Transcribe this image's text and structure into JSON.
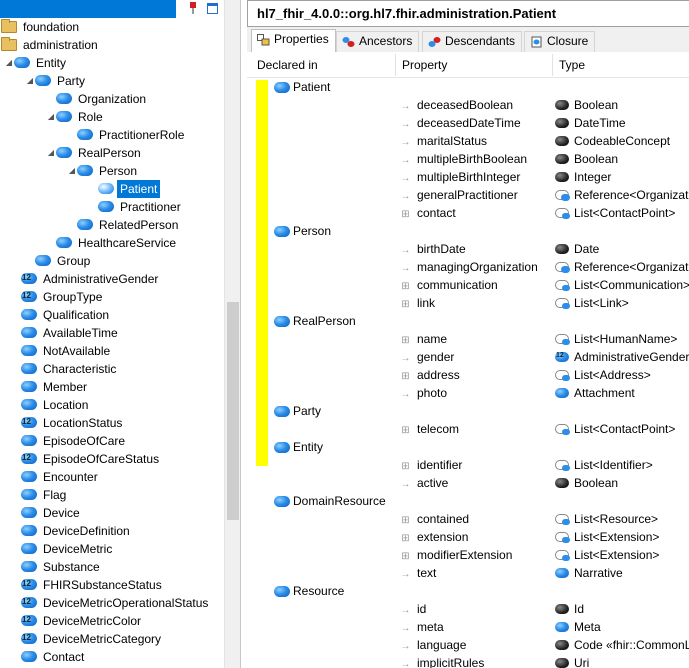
{
  "left_panel": {
    "tree": [
      {
        "label": "foundation",
        "icon": "folder",
        "depth": 0,
        "toggle": ""
      },
      {
        "label": "administration",
        "icon": "folder",
        "depth": 0,
        "toggle": ""
      },
      {
        "label": "Entity",
        "icon": "class",
        "depth": 1,
        "toggle": "open"
      },
      {
        "label": "Party",
        "icon": "class",
        "depth": 2,
        "toggle": "open"
      },
      {
        "label": "Organization",
        "icon": "class",
        "depth": 3,
        "toggle": ""
      },
      {
        "label": "Role",
        "icon": "class",
        "depth": 3,
        "toggle": "open"
      },
      {
        "label": "PractitionerRole",
        "icon": "class",
        "depth": 4,
        "toggle": ""
      },
      {
        "label": "RealPerson",
        "icon": "class",
        "depth": 3,
        "toggle": "open"
      },
      {
        "label": "Person",
        "icon": "class",
        "depth": 4,
        "toggle": "open"
      },
      {
        "label": "Patient",
        "icon": "class",
        "depth": 5,
        "toggle": "",
        "selected": true
      },
      {
        "label": "Practitioner",
        "icon": "class",
        "depth": 5,
        "toggle": ""
      },
      {
        "label": "RelatedPerson",
        "icon": "class",
        "depth": 4,
        "toggle": ""
      },
      {
        "label": "HealthcareService",
        "icon": "class",
        "depth": 3,
        "toggle": ""
      },
      {
        "label": "Group",
        "icon": "class",
        "depth": 2,
        "toggle": ""
      },
      {
        "label": "AdministrativeGender",
        "icon": "enum",
        "depth": 0,
        "toggle": ""
      },
      {
        "label": "GroupType",
        "icon": "enum",
        "depth": 0,
        "toggle": ""
      },
      {
        "label": "Qualification",
        "icon": "class",
        "depth": 0,
        "toggle": ""
      },
      {
        "label": "AvailableTime",
        "icon": "class",
        "depth": 0,
        "toggle": ""
      },
      {
        "label": "NotAvailable",
        "icon": "class",
        "depth": 0,
        "toggle": ""
      },
      {
        "label": "Characteristic",
        "icon": "class",
        "depth": 0,
        "toggle": ""
      },
      {
        "label": "Member",
        "icon": "class",
        "depth": 0,
        "toggle": ""
      },
      {
        "label": "Location",
        "icon": "class",
        "depth": 0,
        "toggle": ""
      },
      {
        "label": "LocationStatus",
        "icon": "enum",
        "depth": 0,
        "toggle": ""
      },
      {
        "label": "EpisodeOfCare",
        "icon": "class",
        "depth": 0,
        "toggle": ""
      },
      {
        "label": "EpisodeOfCareStatus",
        "icon": "enum",
        "depth": 0,
        "toggle": ""
      },
      {
        "label": "Encounter",
        "icon": "class",
        "depth": 0,
        "toggle": ""
      },
      {
        "label": "Flag",
        "icon": "class",
        "depth": 0,
        "toggle": ""
      },
      {
        "label": "Device",
        "icon": "class",
        "depth": 0,
        "toggle": ""
      },
      {
        "label": "DeviceDefinition",
        "icon": "class",
        "depth": 0,
        "toggle": ""
      },
      {
        "label": "DeviceMetric",
        "icon": "class",
        "depth": 0,
        "toggle": ""
      },
      {
        "label": "Substance",
        "icon": "class",
        "depth": 0,
        "toggle": ""
      },
      {
        "label": "FHIRSubstanceStatus",
        "icon": "enum",
        "depth": 0,
        "toggle": ""
      },
      {
        "label": "DeviceMetricOperationalStatus",
        "icon": "enum",
        "depth": 0,
        "toggle": ""
      },
      {
        "label": "DeviceMetricColor",
        "icon": "enum",
        "depth": 0,
        "toggle": ""
      },
      {
        "label": "DeviceMetricCategory",
        "icon": "enum",
        "depth": 0,
        "toggle": ""
      },
      {
        "label": "Contact",
        "icon": "class",
        "depth": 0,
        "toggle": ""
      }
    ]
  },
  "right_panel": {
    "title": "hl7_fhir_4.0.0::org.hl7.fhir.administration.Patient",
    "tabs": [
      {
        "label": "Properties",
        "icon": "properties-icon",
        "active": true
      },
      {
        "label": "Ancestors",
        "icon": "ancestors-icon",
        "active": false
      },
      {
        "label": "Descendants",
        "icon": "descendants-icon",
        "active": false
      },
      {
        "label": "Closure",
        "icon": "closure-icon",
        "active": false
      }
    ],
    "columns": [
      "Declared in",
      "Property",
      "Type"
    ],
    "rows": [
      {
        "kind": "class",
        "name": "Patient"
      },
      {
        "kind": "prop",
        "name": "deceasedBoolean",
        "type": "Boolean",
        "ticon": "prim"
      },
      {
        "kind": "prop",
        "name": "deceasedDateTime",
        "type": "DateTime",
        "ticon": "prim"
      },
      {
        "kind": "prop",
        "name": "maritalStatus",
        "type": "CodeableConcept",
        "ticon": "prim"
      },
      {
        "kind": "prop",
        "name": "multipleBirthBoolean",
        "type": "Boolean",
        "ticon": "prim"
      },
      {
        "kind": "prop",
        "name": "multipleBirthInteger",
        "type": "Integer",
        "ticon": "prim"
      },
      {
        "kind": "prop",
        "name": "generalPractitioner",
        "type": "Reference<Organizati",
        "ticon": "ref"
      },
      {
        "kind": "prop",
        "name": "contact",
        "type": "List<ContactPoint>",
        "ticon": "list"
      },
      {
        "kind": "class",
        "name": "Person"
      },
      {
        "kind": "prop",
        "name": "birthDate",
        "type": "Date",
        "ticon": "prim"
      },
      {
        "kind": "prop",
        "name": "managingOrganization",
        "type": "Reference<Organizati",
        "ticon": "ref"
      },
      {
        "kind": "prop",
        "name": "communication",
        "type": "List<Communication>",
        "ticon": "list"
      },
      {
        "kind": "prop",
        "name": "link",
        "type": "List<Link>",
        "ticon": "list"
      },
      {
        "kind": "class",
        "name": "RealPerson"
      },
      {
        "kind": "prop",
        "name": "name",
        "type": "List<HumanName>",
        "ticon": "list"
      },
      {
        "kind": "prop",
        "name": "gender",
        "type": "AdministrativeGender",
        "ticon": "enum"
      },
      {
        "kind": "prop",
        "name": "address",
        "type": "List<Address>",
        "ticon": "list"
      },
      {
        "kind": "prop",
        "name": "photo",
        "type": "Attachment",
        "ticon": "class"
      },
      {
        "kind": "class",
        "name": "Party"
      },
      {
        "kind": "prop",
        "name": "telecom",
        "type": "List<ContactPoint>",
        "ticon": "list"
      },
      {
        "kind": "class",
        "name": "Entity"
      },
      {
        "kind": "prop",
        "name": "identifier",
        "type": "List<Identifier>",
        "ticon": "list"
      },
      {
        "kind": "prop",
        "name": "active",
        "type": "Boolean",
        "ticon": "prim"
      },
      {
        "kind": "class",
        "name": "DomainResource"
      },
      {
        "kind": "prop",
        "name": "contained",
        "type": "List<Resource>",
        "ticon": "list"
      },
      {
        "kind": "prop",
        "name": "extension",
        "type": "List<Extension>",
        "ticon": "list"
      },
      {
        "kind": "prop",
        "name": "modifierExtension",
        "type": "List<Extension>",
        "ticon": "list"
      },
      {
        "kind": "prop",
        "name": "text",
        "type": "Narrative",
        "ticon": "class"
      },
      {
        "kind": "class",
        "name": "Resource"
      },
      {
        "kind": "prop",
        "name": "id",
        "type": "Id",
        "ticon": "prim"
      },
      {
        "kind": "prop",
        "name": "meta",
        "type": "Meta",
        "ticon": "class"
      },
      {
        "kind": "prop",
        "name": "language",
        "type": "Code «fhir::CommonL",
        "ticon": "prim"
      },
      {
        "kind": "prop",
        "name": "implicitRules",
        "type": "Uri",
        "ticon": "prim"
      }
    ]
  },
  "colors": {
    "selection": "#0078d7",
    "highlight": "#ffff00",
    "class_icon": "#2c8ee8"
  }
}
